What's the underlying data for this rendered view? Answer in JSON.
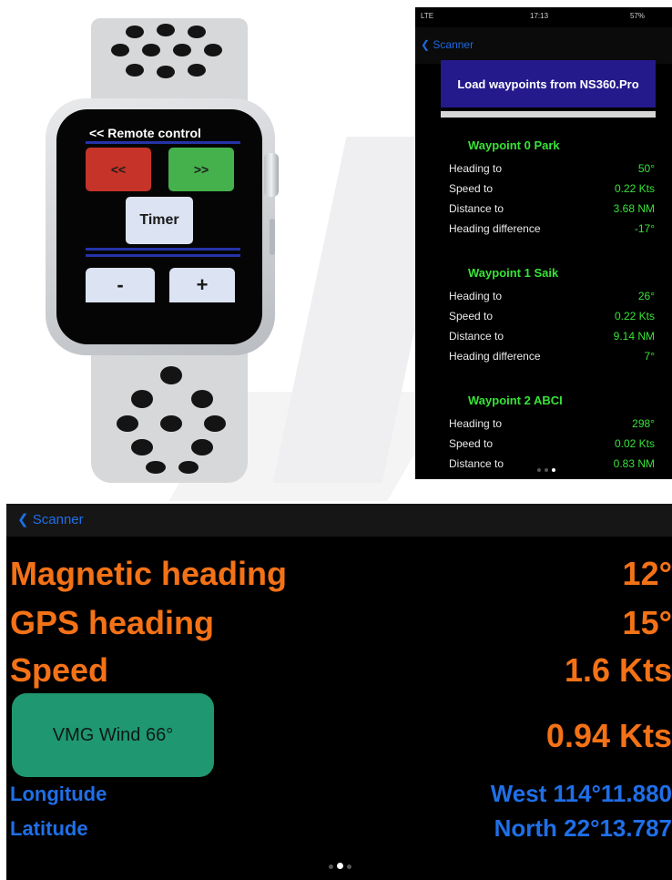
{
  "watch": {
    "title": "<< Remote control",
    "prev_label": "<<",
    "next_label": ">>",
    "timer_label": "Timer",
    "minus_label": "-",
    "plus_label": "+"
  },
  "phone": {
    "status": {
      "signal": "LTE",
      "time": "17:13",
      "battery": "57%"
    },
    "nav": {
      "back_label": "Scanner"
    },
    "load_button_label": "Load waypoints from NS360.Pro",
    "waypoints": [
      {
        "title": "Waypoint 0  Park",
        "rows": [
          {
            "label": "Heading to",
            "value": "50°"
          },
          {
            "label": "Speed to",
            "value": "0.22 Kts"
          },
          {
            "label": "Distance to",
            "value": "3.68 NM"
          },
          {
            "label": "Heading difference",
            "value": "-17°"
          }
        ]
      },
      {
        "title": "Waypoint 1  Saik",
        "rows": [
          {
            "label": "Heading to",
            "value": "26°"
          },
          {
            "label": "Speed to",
            "value": "0.22 Kts"
          },
          {
            "label": "Distance to",
            "value": "9.14 NM"
          },
          {
            "label": "Heading difference",
            "value": "7°"
          }
        ]
      },
      {
        "title": "Waypoint 2  ABCI",
        "rows": [
          {
            "label": "Heading to",
            "value": "298°"
          },
          {
            "label": "Speed to",
            "value": "0.02 Kts"
          },
          {
            "label": "Distance to",
            "value": "0.83 NM"
          }
        ]
      }
    ]
  },
  "dashboard": {
    "nav": {
      "back_label": "Scanner"
    },
    "magnetic_heading": {
      "label": "Magnetic heading",
      "value": "12°"
    },
    "gps_heading": {
      "label": "GPS heading",
      "value": "15°"
    },
    "speed": {
      "label": "Speed",
      "value": "1.6 Kts"
    },
    "vmg": {
      "button_label": "VMG Wind 66°",
      "value": "0.94 Kts"
    },
    "longitude": {
      "label": "Longitude",
      "value": "West 114°11.880"
    },
    "latitude": {
      "label": "Latitude",
      "value": "North 22°13.787"
    }
  },
  "colors": {
    "orange": "#f47216",
    "blue": "#1f6fe8",
    "green_text": "#38e238",
    "teal_button": "#1f9770",
    "load_button": "#241a8c"
  }
}
